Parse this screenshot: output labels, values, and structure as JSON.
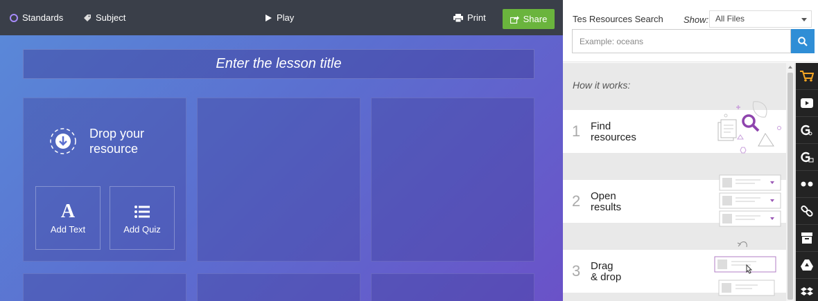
{
  "topbar": {
    "standards": "Standards",
    "subject": "Subject",
    "play": "Play",
    "print": "Print",
    "share": "Share"
  },
  "canvas": {
    "title_placeholder": "Enter the lesson title",
    "drop_line1": "Drop your",
    "drop_line2": "resource",
    "add_text": "Add Text",
    "add_quiz": "Add Quiz"
  },
  "panel": {
    "search_title": "Tes Resources Search",
    "show_label": "Show:",
    "show_value": "All Files",
    "search_placeholder": "Example: oceans",
    "how_title": "How it works:",
    "steps": [
      {
        "num": "1",
        "line1": "Find",
        "line2": "resources"
      },
      {
        "num": "2",
        "line1": "Open",
        "line2": "results"
      },
      {
        "num": "3",
        "line1": "Drag",
        "line2": "& drop"
      }
    ],
    "source_icons": [
      "cart-icon",
      "youtube-icon",
      "google-search-icon",
      "google-image-icon",
      "flickr-icon",
      "link-icon",
      "archive-icon",
      "google-drive-icon",
      "dropbox-icon"
    ]
  },
  "colors": {
    "topbar": "#3a3f49",
    "share_green": "#6ab43d",
    "search_blue": "#2f8ed6",
    "cart_orange": "#f6a623"
  }
}
